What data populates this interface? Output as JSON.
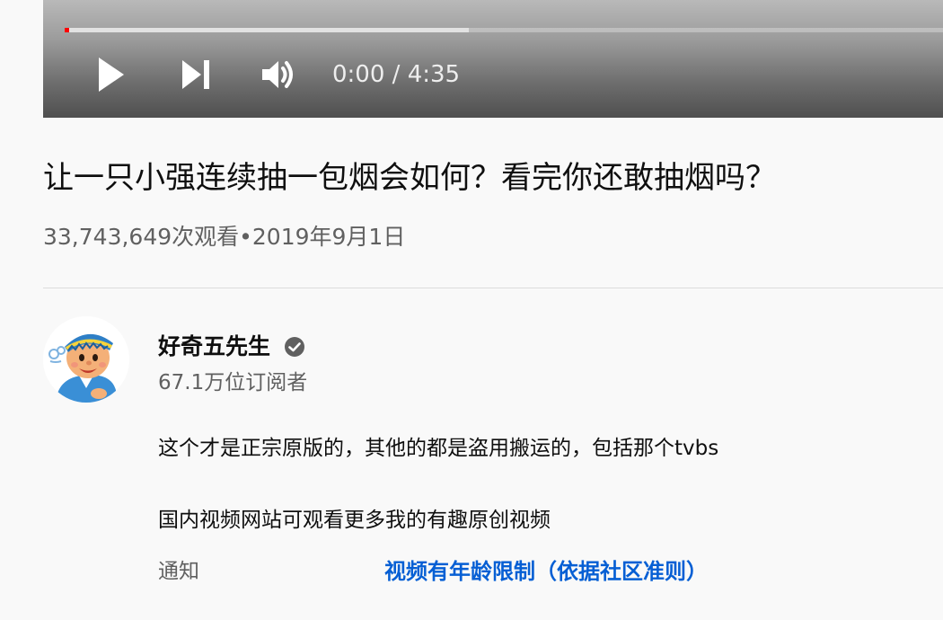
{
  "player": {
    "current_time": "0:00",
    "separator": "/",
    "duration": "4:35",
    "played_fraction": 0.0,
    "buffered_fraction": 0.46,
    "progress_color": "#ff0000",
    "icons": {
      "play": "play-icon",
      "next": "skip-next-icon",
      "volume": "volume-icon"
    }
  },
  "video": {
    "title": "让一只小强连续抽一包烟会如何？看完你还敢抽烟吗？",
    "views": "33,743,649次观看",
    "dot": "•",
    "date": "2019年9月1日"
  },
  "channel": {
    "name": "好奇五先生",
    "subscribers": "67.1万位订阅者",
    "verified_icon": "verified-check-icon",
    "avatar_icon": "cartoon-avatar-icon"
  },
  "description": {
    "line1": "这个才是正宗原版的，其他的都是盗用搬运的，包括那个tvbs",
    "line2": "国内视频网站可观看更多我的有趣原创视频"
  },
  "notice": {
    "label": "通知",
    "link_text": "视频有年龄限制（依据社区准则）",
    "link_color": "#065fd4"
  }
}
